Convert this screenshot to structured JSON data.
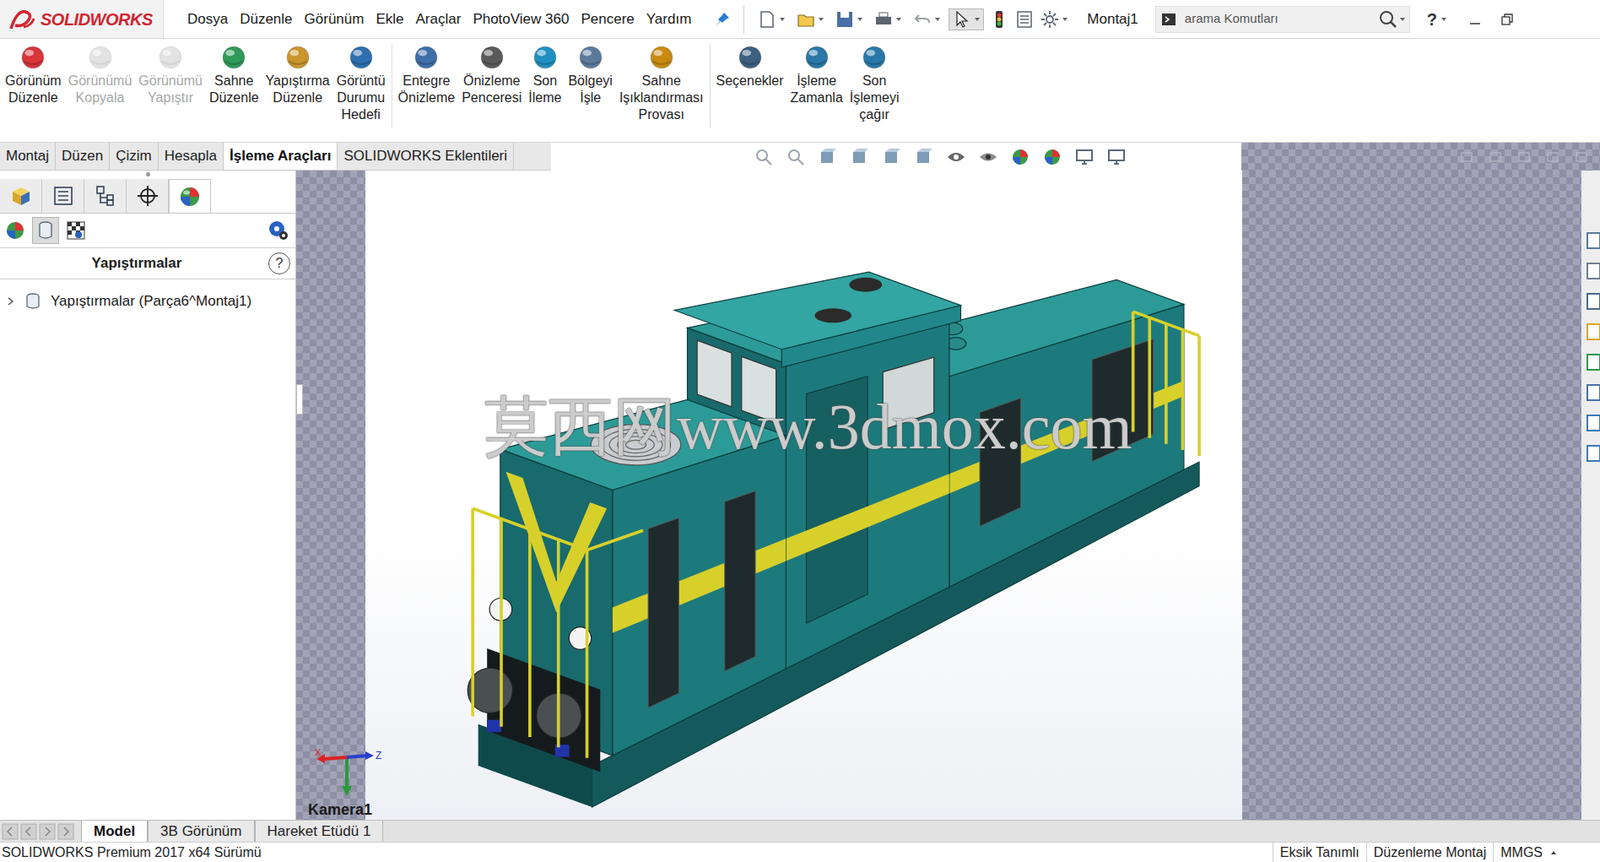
{
  "app": {
    "logo": "SOLIDWORKS",
    "document": "Montaj1"
  },
  "menu": [
    "Dosya",
    "Düzenle",
    "Görünüm",
    "Ekle",
    "Araçlar",
    "PhotoView 360",
    "Pencere",
    "Yardım"
  ],
  "search": {
    "placeholder": "arama Komutları"
  },
  "help": "?",
  "ribbon": [
    {
      "lines": [
        "Görünüm",
        "Düzenle"
      ],
      "disabled": false,
      "group": 1
    },
    {
      "lines": [
        "Görünümü",
        "Kopyala"
      ],
      "disabled": true,
      "group": 1
    },
    {
      "lines": [
        "Görünümü",
        "Yapıştır"
      ],
      "disabled": true,
      "group": 1
    },
    {
      "lines": [
        "Sahne",
        "Düzenle"
      ],
      "disabled": false,
      "group": 1
    },
    {
      "lines": [
        "Yapıştırma",
        "Düzenle"
      ],
      "disabled": false,
      "group": 1
    },
    {
      "lines": [
        "Görüntü",
        "Durumu",
        "Hedefi"
      ],
      "disabled": false,
      "group": 1
    },
    {
      "lines": [
        "Entegre",
        "Önizleme"
      ],
      "disabled": false,
      "group": 2
    },
    {
      "lines": [
        "Önizleme",
        "Penceresi"
      ],
      "disabled": false,
      "group": 2
    },
    {
      "lines": [
        "Son",
        "İleme"
      ],
      "disabled": false,
      "group": 2
    },
    {
      "lines": [
        "Bölgeyi",
        "İşle"
      ],
      "disabled": false,
      "group": 2
    },
    {
      "lines": [
        "Sahne",
        "Işıklandırması",
        "Provası"
      ],
      "disabled": false,
      "group": 2
    },
    {
      "lines": [
        "Seçenekler"
      ],
      "disabled": false,
      "group": 3
    },
    {
      "lines": [
        "İşleme",
        "Zamanla"
      ],
      "disabled": false,
      "group": 3
    },
    {
      "lines": [
        "Son",
        "İşlemeyi",
        "çağır"
      ],
      "disabled": false,
      "group": 3
    }
  ],
  "command_tabs": [
    {
      "label": "Montaj",
      "selected": false
    },
    {
      "label": "Düzen",
      "selected": false
    },
    {
      "label": "Çizim",
      "selected": false
    },
    {
      "label": "Hesapla",
      "selected": false
    },
    {
      "label": "İşleme Araçları",
      "selected": true
    },
    {
      "label": "SOLIDWORKS Eklentileri",
      "selected": false
    }
  ],
  "panel": {
    "feature_tabs": [
      {
        "selected": false
      },
      {
        "selected": false
      },
      {
        "selected": false
      },
      {
        "selected": false
      },
      {
        "selected": true
      }
    ],
    "appearance_tabs": [
      {
        "selected": false
      },
      {
        "selected": true
      },
      {
        "selected": false
      }
    ],
    "title": "Yapıştırmalar",
    "help": "?",
    "tree": [
      {
        "label": "Yapıştırmalar (Parça6^Montaj1)",
        "expanded": false
      }
    ]
  },
  "viewport": {
    "watermark": "莫西网www.3dmox.com",
    "camera": "Kamera1",
    "axes": {
      "x": "X",
      "z": "Z"
    }
  },
  "bottom_tabs": [
    {
      "label": "Model",
      "selected": true
    },
    {
      "label": "3B Görünüm",
      "selected": false
    },
    {
      "label": "Hareket Etüdü 1",
      "selected": false
    }
  ],
  "status_bar": {
    "version": "SOLIDWORKS Premium 2017 x64 Sürümü",
    "items": [
      "Eksik Tanımlı",
      "Düzenleme Montaj",
      "MMGS"
    ]
  }
}
